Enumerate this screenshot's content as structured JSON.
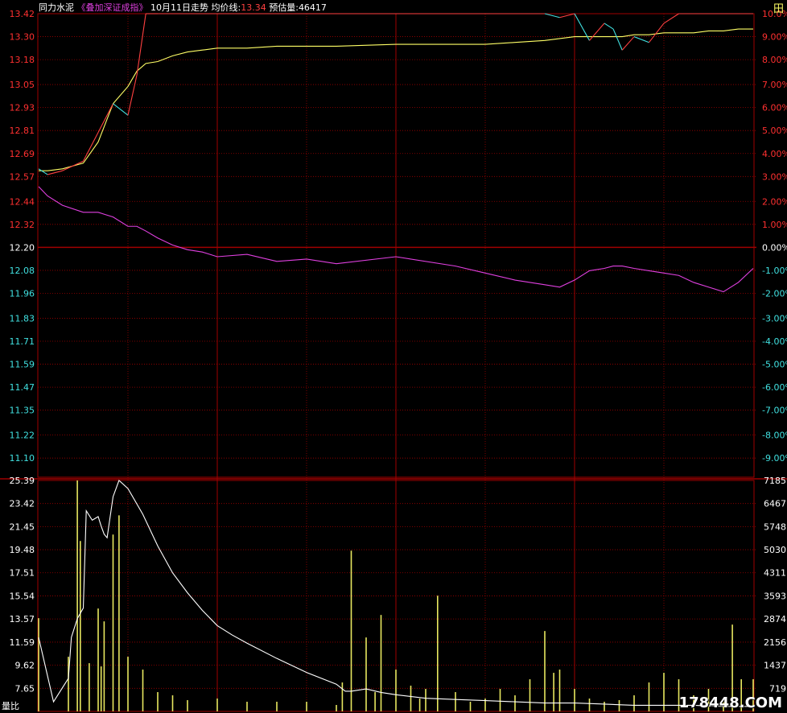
{
  "header": {
    "stock_name": "同力水泥",
    "overlay_label": "《叠加深证成指》",
    "date_label": "10月11日走势",
    "avg_label": "均价线:",
    "avg_value": "13.34",
    "est_vol_label": "预估量:",
    "est_vol_value": "46417"
  },
  "corner_label": "田",
  "watermark": "178448.COM",
  "colors": {
    "background": "#000000",
    "grid": "#a00000",
    "price_up": "#ff4040",
    "price_down": "#40e0e0",
    "avg_line": "#ffff66",
    "index_line": "#e040e0",
    "ratio_line": "#ffffff",
    "volume_bar": "#e8e860",
    "axis_red": "#ff3030",
    "axis_cyan": "#40e0e0"
  },
  "chart_data": [
    {
      "type": "line",
      "name": "intraday-price",
      "y_ticks_price": [
        "13.42",
        "13.30",
        "13.18",
        "13.05",
        "12.93",
        "12.81",
        "12.69",
        "12.57",
        "12.44",
        "12.32",
        "12.20",
        "12.08",
        "11.96",
        "11.83",
        "11.71",
        "11.59",
        "11.47",
        "11.35",
        "11.22",
        "11.10"
      ],
      "y_ticks_pct": [
        "10.0%",
        "9.00%",
        "8.00%",
        "7.00%",
        "6.00%",
        "5.00%",
        "4.00%",
        "3.00%",
        "2.00%",
        "1.00%",
        "0.00%",
        "-1.00%",
        "-2.00%",
        "-3.00%",
        "-4.00%",
        "-5.00%",
        "-6.00%",
        "-7.00%",
        "-8.00%",
        "-9.00%"
      ],
      "ylim": [
        11.0,
        13.42
      ],
      "prev_close": 12.2,
      "x": [
        0,
        3,
        8,
        15,
        20,
        25,
        30,
        33,
        36,
        40,
        45,
        50,
        55,
        60,
        70,
        80,
        90,
        100,
        120,
        140,
        150,
        160,
        170,
        175,
        180,
        185,
        190,
        193,
        196,
        200,
        205,
        210,
        215,
        220,
        225,
        230,
        235,
        240
      ],
      "series": [
        {
          "values": [
            12.61,
            12.58,
            12.6,
            12.65,
            12.8,
            12.95,
            12.89,
            13.1,
            13.42,
            13.42,
            13.42,
            13.42,
            13.42,
            13.42,
            13.42,
            13.42,
            13.42,
            13.42,
            13.42,
            13.42,
            13.42,
            13.42,
            13.42,
            13.4,
            13.42,
            13.28,
            13.37,
            13.34,
            13.23,
            13.3,
            13.27,
            13.37,
            13.42,
            13.42,
            13.42,
            13.42,
            13.42,
            13.42
          ]
        },
        {
          "values": [
            12.6,
            12.6,
            12.61,
            12.64,
            12.75,
            12.95,
            13.04,
            13.12,
            13.16,
            13.17,
            13.2,
            13.22,
            13.23,
            13.24,
            13.24,
            13.25,
            13.25,
            13.25,
            13.26,
            13.26,
            13.26,
            13.27,
            13.28,
            13.29,
            13.3,
            13.3,
            13.3,
            13.3,
            13.3,
            13.31,
            13.31,
            13.32,
            13.32,
            13.32,
            13.33,
            13.33,
            13.34,
            13.34
          ]
        },
        {
          "values": [
            2.6,
            2.2,
            1.8,
            1.5,
            1.5,
            1.3,
            0.9,
            0.9,
            0.7,
            0.4,
            0.1,
            -0.1,
            -0.2,
            -0.4,
            -0.3,
            -0.6,
            -0.5,
            -0.7,
            -0.4,
            -0.8,
            -1.1,
            -1.4,
            -1.6,
            -1.7,
            -1.4,
            -1.0,
            -0.9,
            -0.8,
            -0.8,
            -0.9,
            -1.0,
            -1.1,
            -1.2,
            -1.5,
            -1.7,
            -1.9,
            -1.5,
            -0.9
          ]
        }
      ]
    },
    {
      "type": "bar",
      "name": "volume-ratio",
      "y_ticks_ratio": [
        "25.39",
        "23.42",
        "21.45",
        "19.48",
        "17.51",
        "15.54",
        "13.57",
        "11.59",
        "9.62",
        "7.65"
      ],
      "y_ticks_vol": [
        "7185",
        "6467",
        "5748",
        "5030",
        "4311",
        "3593",
        "2874",
        "2156",
        "1437",
        "719"
      ],
      "ratio_ylim": [
        5.68,
        25.39
      ],
      "vol_ylim": [
        0,
        7185
      ],
      "bar_x": [
        0,
        10,
        13,
        14,
        17,
        20,
        21,
        22,
        25,
        27,
        30,
        35,
        40,
        45,
        50,
        60,
        70,
        80,
        90,
        100,
        102,
        105,
        110,
        113,
        115,
        120,
        125,
        128,
        130,
        134,
        140,
        145,
        150,
        155,
        160,
        165,
        170,
        173,
        175,
        180,
        185,
        190,
        195,
        200,
        205,
        210,
        215,
        220,
        225,
        230,
        233,
        236,
        240
      ],
      "bar_values": [
        2900,
        1700,
        7185,
        5300,
        1500,
        3200,
        1400,
        2800,
        5500,
        6100,
        1700,
        1300,
        600,
        500,
        350,
        400,
        300,
        300,
        300,
        200,
        900,
        5000,
        2300,
        600,
        3000,
        1300,
        800,
        400,
        700,
        3600,
        600,
        300,
        400,
        700,
        500,
        1000,
        2500,
        1200,
        1300,
        700,
        400,
        300,
        350,
        500,
        900,
        1200,
        1000,
        500,
        700,
        300,
        2700,
        1000,
        1000
      ],
      "ratio_x": [
        0,
        5,
        10,
        11,
        13,
        15,
        16,
        18,
        20,
        21,
        22,
        23,
        25,
        27,
        30,
        35,
        40,
        45,
        50,
        55,
        60,
        65,
        70,
        80,
        90,
        100,
        103,
        105,
        110,
        115,
        120,
        130,
        140,
        150,
        160,
        170,
        180,
        190,
        200,
        210,
        220,
        230,
        240
      ],
      "ratio_values": [
        12.0,
        6.5,
        8.5,
        12.0,
        13.6,
        14.5,
        22.8,
        22.0,
        22.3,
        21.5,
        20.8,
        20.5,
        24.0,
        25.39,
        24.7,
        22.5,
        19.8,
        17.5,
        15.8,
        14.3,
        13.0,
        12.2,
        11.5,
        10.2,
        9.0,
        8.0,
        7.4,
        7.4,
        7.6,
        7.3,
        7.1,
        6.8,
        6.7,
        6.6,
        6.5,
        6.4,
        6.4,
        6.3,
        6.2,
        6.2,
        6.2,
        6.1,
        6.1
      ]
    }
  ]
}
